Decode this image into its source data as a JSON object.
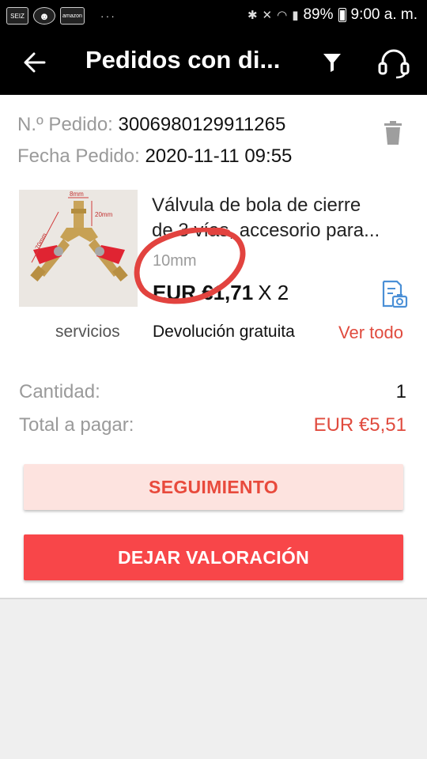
{
  "status_bar": {
    "badges": [
      "SEIZ",
      "☻",
      "amazon"
    ],
    "dots": "···",
    "battery": "89%",
    "time": "9:00 a. m."
  },
  "app_bar": {
    "title": "Pedidos con di..."
  },
  "order": {
    "number_label": "N.º Pedido:",
    "number_value": "3006980129911265",
    "date_label": "Fecha Pedido:",
    "date_value": "2020-11-11 09:55"
  },
  "product": {
    "title_line1": "Válvula de bola de cierre",
    "title_line2": "de 3 vías, accesorio para...",
    "variant": "10mm",
    "price": "EUR €1,71",
    "quantity": "X 2",
    "image_labels": [
      "8mm",
      "20mm",
      "70mm"
    ]
  },
  "services": {
    "label": "servicios",
    "free_return": "Devolución gratuita",
    "see_all": "Ver todo"
  },
  "summary": {
    "quantity_label": "Cantidad:",
    "quantity_value": "1",
    "total_label": "Total a pagar:",
    "total_value": "EUR €5,51"
  },
  "buttons": {
    "tracking": "SEGUIMIENTO",
    "review": "DEJAR VALORACIÓN"
  },
  "colors": {
    "accent": "#e04b3e",
    "primary_button": "#f84649",
    "secondary_button_bg": "#fde3df",
    "annotation": "#e2433f"
  }
}
